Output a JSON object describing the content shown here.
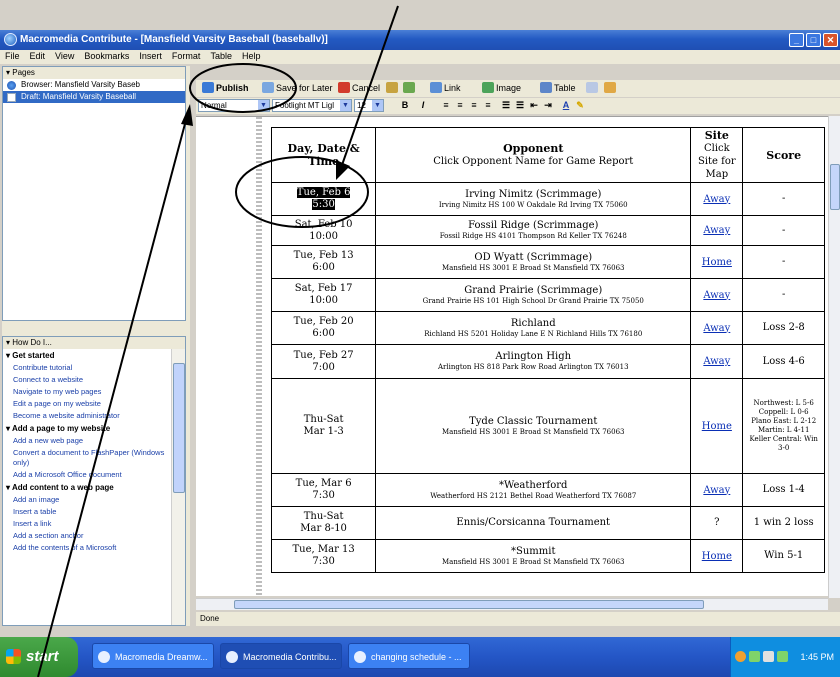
{
  "window": {
    "title": "Macromedia Contribute - [Mansfield Varsity Baseball (baseballv)]"
  },
  "menu": [
    "File",
    "Edit",
    "View",
    "Bookmarks",
    "Insert",
    "Format",
    "Table",
    "Help"
  ],
  "pages_panel": {
    "header": "Pages",
    "items": [
      {
        "label": "Browser: Mansfield Varsity Baseb",
        "selected": false
      },
      {
        "label": "Draft: Mansfield Varsity Baseball",
        "selected": true
      }
    ]
  },
  "how_do_i": {
    "header": "How Do I...",
    "sections": [
      {
        "title": "Get started",
        "links": [
          "Contribute tutorial",
          "Connect to a website",
          "Navigate to my web pages",
          "Edit a page on my website",
          "Become a website administrator"
        ]
      },
      {
        "title": "Add a page to my website",
        "links": [
          "Add a new web page",
          "Convert a document to FlashPaper (Windows only)",
          "Add a Microsoft Office document"
        ]
      },
      {
        "title": "Add content to a web page",
        "links": [
          "Add an image",
          "Insert a table",
          "Insert a link",
          "Add a section anchor",
          "Add the contents of a Microsoft"
        ]
      }
    ]
  },
  "toolbar": {
    "publish": "Publish",
    "save_for_later": "Save for Later",
    "cancel": "Cancel",
    "link": "Link",
    "image": "Image",
    "table": "Table"
  },
  "format_bar": {
    "style": "Normal",
    "font": "Footlight MT Ligl",
    "size": "12",
    "bold": "B",
    "italic": "I"
  },
  "schedule": {
    "headers": {
      "date": "Day, Date & Time",
      "opponent": "Opponent",
      "opponent_sub": "Click Opponent Name for Game Report",
      "site": "Site",
      "site_sub": "Click Site for Map",
      "score": "Score"
    },
    "rows": [
      {
        "day": "Tue, Feb 6",
        "time": "5:30",
        "opponent": "Irving Nimitz (Scrimmage)",
        "address": "Irving Nimitz HS 100 W Oakdale Rd Irving TX 75060",
        "site": "Away",
        "score": "-"
      },
      {
        "day": "Sat, Feb 10",
        "time": "10:00",
        "opponent": "Fossil Ridge (Scrimmage)",
        "address": "Fossil Ridge HS 4101 Thompson Rd Keller TX 76248",
        "site": "Away",
        "score": "-"
      },
      {
        "day": "Tue, Feb 13",
        "time": "6:00",
        "opponent": "OD Wyatt (Scrimmage)",
        "address": "Mansfield HS 3001 E Broad St Mansfield TX 76063",
        "site": "Home",
        "score": "-"
      },
      {
        "day": "Sat, Feb 17",
        "time": "10:00",
        "opponent": "Grand Prairie (Scrimmage)",
        "address": "Grand Prairie HS 101 High School Dr Grand Prairie TX 75050",
        "site": "Away",
        "score": "-"
      },
      {
        "day": "Tue, Feb 20",
        "time": "6:00",
        "opponent": "Richland",
        "address": "Richland HS 5201 Holiday Lane E N Richland Hills TX 76180",
        "site": "Away",
        "score": "Loss 2-8"
      },
      {
        "day": "Tue, Feb 27",
        "time": "7:00",
        "opponent": "Arlington High",
        "address": "Arlington HS 818 Park Row Road Arlington TX 76013",
        "site": "Away",
        "score": "Loss 4-6"
      },
      {
        "day": "Thu-Sat",
        "time": "Mar 1-3",
        "opponent": "Tyde Classic Tournament",
        "address": "Mansfield HS 3001 E Broad St Mansfield TX 76063",
        "site": "Home",
        "score_lines": [
          "Northwest: L 5-6",
          "Coppell: L 0-6",
          "Plano East: L 2-12",
          "Martin: L 4-11",
          "Keller Central: Win 3-0"
        ]
      },
      {
        "day": "Tue, Mar 6",
        "time": "7:30",
        "opponent": "*Weatherford",
        "address": "Weatherford HS 2121 Bethel Road Weatherford TX 76087",
        "site": "Away",
        "score": "Loss 1-4"
      },
      {
        "day": "Thu-Sat",
        "time": "Mar 8-10",
        "opponent": "Ennis/Corsicanna Tournament",
        "address": "",
        "site": "?",
        "score": "1 win 2 loss"
      },
      {
        "day": "Tue, Mar 13",
        "time": "7:30",
        "opponent": "*Summit",
        "address": "Mansfield HS 3001 E Broad St Mansfield TX 76063",
        "site": "Home",
        "score": "Win 5-1"
      }
    ]
  },
  "status": "Done",
  "taskbar": {
    "start": "start",
    "tasks": [
      "Macromedia Dreamw...",
      "Macromedia Contribu...",
      "changing schedule - ..."
    ],
    "clock": "1:45 PM"
  }
}
